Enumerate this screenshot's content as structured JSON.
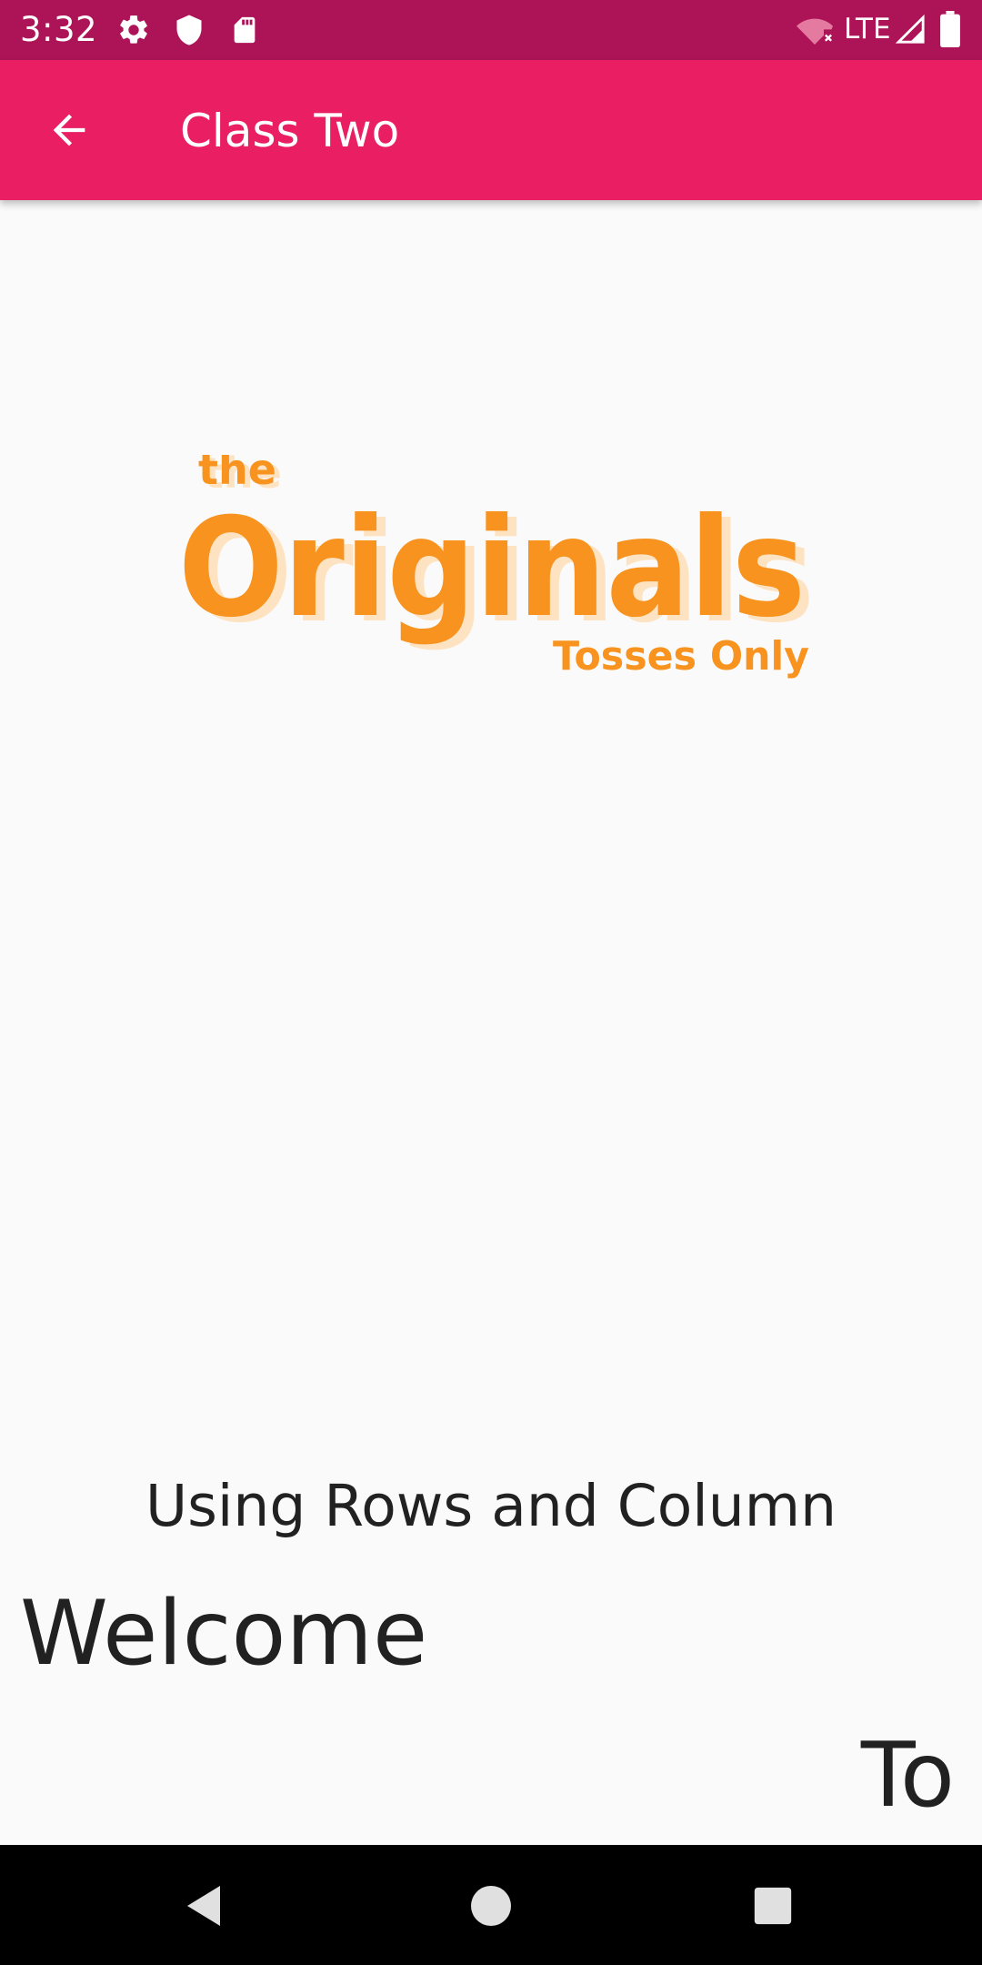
{
  "status_bar": {
    "time": "3:32",
    "network": "LTE",
    "icons": [
      "settings-icon",
      "shield-icon",
      "sd-card-icon",
      "wifi-off-icon",
      "cell-signal-icon",
      "battery-icon"
    ]
  },
  "app_bar": {
    "title": "Class Two",
    "back_icon": "arrow-back-icon"
  },
  "logo": {
    "line1": "the",
    "line2": "Originals",
    "line3": "Tosses Only",
    "color": "#f7931e"
  },
  "content": {
    "subtitle": "Using Rows and Column",
    "welcome": "Welcome",
    "to": "To"
  },
  "nav_bar": {
    "icons": [
      "nav-back-icon",
      "nav-home-icon",
      "nav-recents-icon"
    ]
  },
  "colors": {
    "status_bar": "#ad1457",
    "app_bar": "#e91e63",
    "background": "#fafafa",
    "text": "#212121"
  }
}
